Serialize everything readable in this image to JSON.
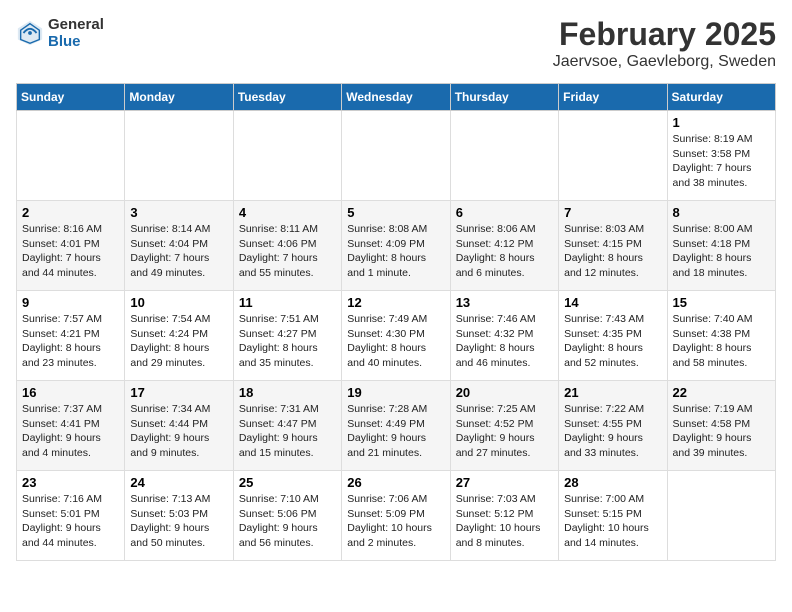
{
  "header": {
    "logo_general": "General",
    "logo_blue": "Blue",
    "title": "February 2025",
    "subtitle": "Jaervsoe, Gaevleborg, Sweden"
  },
  "days_of_week": [
    "Sunday",
    "Monday",
    "Tuesday",
    "Wednesday",
    "Thursday",
    "Friday",
    "Saturday"
  ],
  "weeks": [
    [
      {
        "day": "",
        "info": ""
      },
      {
        "day": "",
        "info": ""
      },
      {
        "day": "",
        "info": ""
      },
      {
        "day": "",
        "info": ""
      },
      {
        "day": "",
        "info": ""
      },
      {
        "day": "",
        "info": ""
      },
      {
        "day": "1",
        "info": "Sunrise: 8:19 AM\nSunset: 3:58 PM\nDaylight: 7 hours and 38 minutes."
      }
    ],
    [
      {
        "day": "2",
        "info": "Sunrise: 8:16 AM\nSunset: 4:01 PM\nDaylight: 7 hours and 44 minutes."
      },
      {
        "day": "3",
        "info": "Sunrise: 8:14 AM\nSunset: 4:04 PM\nDaylight: 7 hours and 49 minutes."
      },
      {
        "day": "4",
        "info": "Sunrise: 8:11 AM\nSunset: 4:06 PM\nDaylight: 7 hours and 55 minutes."
      },
      {
        "day": "5",
        "info": "Sunrise: 8:08 AM\nSunset: 4:09 PM\nDaylight: 8 hours and 1 minute."
      },
      {
        "day": "6",
        "info": "Sunrise: 8:06 AM\nSunset: 4:12 PM\nDaylight: 8 hours and 6 minutes."
      },
      {
        "day": "7",
        "info": "Sunrise: 8:03 AM\nSunset: 4:15 PM\nDaylight: 8 hours and 12 minutes."
      },
      {
        "day": "8",
        "info": "Sunrise: 8:00 AM\nSunset: 4:18 PM\nDaylight: 8 hours and 18 minutes."
      }
    ],
    [
      {
        "day": "9",
        "info": "Sunrise: 7:57 AM\nSunset: 4:21 PM\nDaylight: 8 hours and 23 minutes."
      },
      {
        "day": "10",
        "info": "Sunrise: 7:54 AM\nSunset: 4:24 PM\nDaylight: 8 hours and 29 minutes."
      },
      {
        "day": "11",
        "info": "Sunrise: 7:51 AM\nSunset: 4:27 PM\nDaylight: 8 hours and 35 minutes."
      },
      {
        "day": "12",
        "info": "Sunrise: 7:49 AM\nSunset: 4:30 PM\nDaylight: 8 hours and 40 minutes."
      },
      {
        "day": "13",
        "info": "Sunrise: 7:46 AM\nSunset: 4:32 PM\nDaylight: 8 hours and 46 minutes."
      },
      {
        "day": "14",
        "info": "Sunrise: 7:43 AM\nSunset: 4:35 PM\nDaylight: 8 hours and 52 minutes."
      },
      {
        "day": "15",
        "info": "Sunrise: 7:40 AM\nSunset: 4:38 PM\nDaylight: 8 hours and 58 minutes."
      }
    ],
    [
      {
        "day": "16",
        "info": "Sunrise: 7:37 AM\nSunset: 4:41 PM\nDaylight: 9 hours and 4 minutes."
      },
      {
        "day": "17",
        "info": "Sunrise: 7:34 AM\nSunset: 4:44 PM\nDaylight: 9 hours and 9 minutes."
      },
      {
        "day": "18",
        "info": "Sunrise: 7:31 AM\nSunset: 4:47 PM\nDaylight: 9 hours and 15 minutes."
      },
      {
        "day": "19",
        "info": "Sunrise: 7:28 AM\nSunset: 4:49 PM\nDaylight: 9 hours and 21 minutes."
      },
      {
        "day": "20",
        "info": "Sunrise: 7:25 AM\nSunset: 4:52 PM\nDaylight: 9 hours and 27 minutes."
      },
      {
        "day": "21",
        "info": "Sunrise: 7:22 AM\nSunset: 4:55 PM\nDaylight: 9 hours and 33 minutes."
      },
      {
        "day": "22",
        "info": "Sunrise: 7:19 AM\nSunset: 4:58 PM\nDaylight: 9 hours and 39 minutes."
      }
    ],
    [
      {
        "day": "23",
        "info": "Sunrise: 7:16 AM\nSunset: 5:01 PM\nDaylight: 9 hours and 44 minutes."
      },
      {
        "day": "24",
        "info": "Sunrise: 7:13 AM\nSunset: 5:03 PM\nDaylight: 9 hours and 50 minutes."
      },
      {
        "day": "25",
        "info": "Sunrise: 7:10 AM\nSunset: 5:06 PM\nDaylight: 9 hours and 56 minutes."
      },
      {
        "day": "26",
        "info": "Sunrise: 7:06 AM\nSunset: 5:09 PM\nDaylight: 10 hours and 2 minutes."
      },
      {
        "day": "27",
        "info": "Sunrise: 7:03 AM\nSunset: 5:12 PM\nDaylight: 10 hours and 8 minutes."
      },
      {
        "day": "28",
        "info": "Sunrise: 7:00 AM\nSunset: 5:15 PM\nDaylight: 10 hours and 14 minutes."
      },
      {
        "day": "",
        "info": ""
      }
    ]
  ]
}
